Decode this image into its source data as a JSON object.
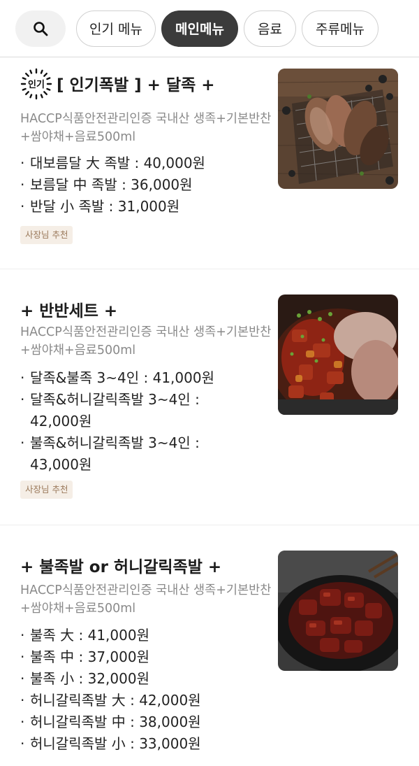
{
  "tabs": {
    "items": [
      {
        "label": "인기 메뉴",
        "active": false
      },
      {
        "label": "메인메뉴",
        "active": true
      },
      {
        "label": "음료",
        "active": false
      },
      {
        "label": "주류메뉴",
        "active": false
      }
    ]
  },
  "menu": {
    "items": [
      {
        "badge_text": "인기",
        "title": "[ 인기폭발 ] + 달족 +",
        "description": "HACCP식품안전관리인증 국내산 생족+기본반찬+쌈야채+음료500ml",
        "prices": [
          "대보름달 大 족발 : 40,000원",
          "보름달 中 족발 : 36,000원",
          "반달 小 족발 : 31,000원"
        ],
        "recommend_label": "사장님 추천"
      },
      {
        "title": "+ 반반세트 +",
        "description": "HACCP식품안전관리인증 국내산 생족+기본반찬+쌈야채+음료500ml",
        "prices": [
          "달족&불족 3~4인 : 41,000원",
          "달족&허니갈릭족발 3~4인 : 42,000원",
          "불족&허니갈릭족발 3~4인 : 43,000원"
        ],
        "recommend_label": "사장님 추천"
      },
      {
        "title": "+ 불족발 or 허니갈릭족발 +",
        "description": "HACCP식품안전관리인증 국내산 생족+기본반찬+쌈야채+음료500ml",
        "prices": [
          "불족 大 : 41,000원",
          "불족 中 : 37,000원",
          "불족 小 : 32,000원",
          "허니갈릭족발 大 : 42,000원",
          "허니갈릭족발 中 : 38,000원",
          "허니갈릭족발 小 : 33,000원"
        ]
      }
    ]
  }
}
